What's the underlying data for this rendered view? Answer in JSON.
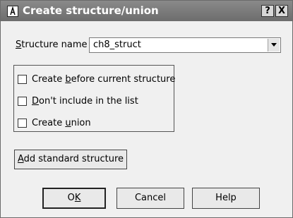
{
  "window": {
    "title": "Create structure/union",
    "help_button": "?",
    "close_button": "X"
  },
  "structure_name": {
    "label_first": "S",
    "label_rest": "tructure name",
    "value": "ch8_struct"
  },
  "options": [
    {
      "pre": "Create ",
      "key": "b",
      "post": "efore current structure",
      "checked": false
    },
    {
      "pre": "",
      "key": "D",
      "post": "on't include in the list",
      "checked": false
    },
    {
      "pre": "Create ",
      "key": "u",
      "post": "nion",
      "checked": false
    }
  ],
  "buttons": {
    "add_standard": {
      "key": "A",
      "rest": "dd standard structure"
    },
    "ok": {
      "pre": "O",
      "key": "K"
    },
    "cancel": "Cancel",
    "help": "Help"
  },
  "icons": {
    "app": "ida-pro-icon",
    "combo_arrow": "chevron-down-icon"
  }
}
